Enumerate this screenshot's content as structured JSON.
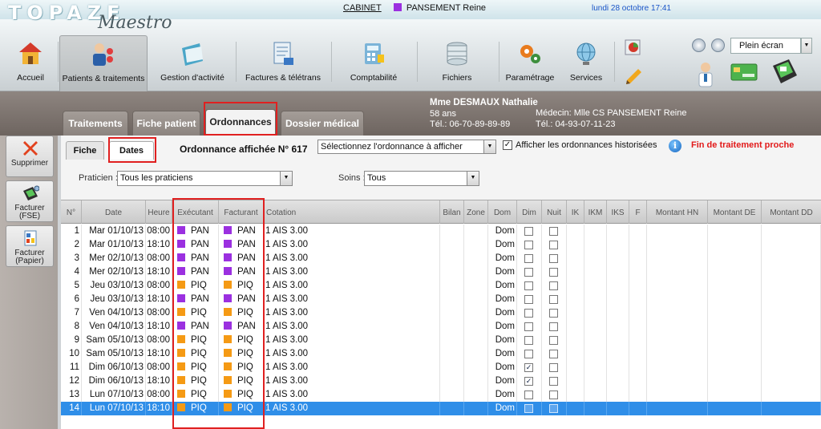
{
  "app": {
    "logo_main": "TOPAZE",
    "logo_sub": "Maestro"
  },
  "topbar": {
    "cabinet_label": "CABINET",
    "cabinet_user": "PANSEMENT Reine",
    "cabinet_color": "#9b30e0",
    "datetime": "lundi 28 octobre 17:41"
  },
  "toolbar": {
    "items": [
      {
        "label": "Accueil",
        "icon": "house-icon"
      },
      {
        "label": "Patients & traitements",
        "icon": "patients-icon"
      },
      {
        "label": "Gestion d'activité",
        "icon": "folder-icon"
      },
      {
        "label": "Factures & télétrans",
        "icon": "invoice-icon"
      },
      {
        "label": "Comptabilité",
        "icon": "calculator-icon"
      },
      {
        "label": "Fichiers",
        "icon": "database-icon"
      },
      {
        "label": "Paramétrage",
        "icon": "gears-icon"
      },
      {
        "label": "Services",
        "icon": "globe-icon"
      }
    ],
    "fullscreen_label": "Plein écran"
  },
  "patient": {
    "tabs": [
      "Traitements",
      "Fiche patient",
      "Ordonnances",
      "Dossier médical"
    ],
    "name": "Mme DESMAUX Nathalie",
    "age": "58 ans",
    "phone": "Tél.: 06-70-89-89-89",
    "doctor": "Médecin: Mlle CS PANSEMENT Reine",
    "doctor_phone": "Tél.: 04-93-07-11-23"
  },
  "sidebar": {
    "buttons": [
      {
        "label_1": "Supprimer",
        "label_2": ""
      },
      {
        "label_1": "Facturer",
        "label_2": "(FSE)"
      },
      {
        "label_1": "Facturer",
        "label_2": "(Papier)"
      }
    ]
  },
  "ordonnance": {
    "subtabs": [
      "Fiche",
      "Dates"
    ],
    "displayed_label": "Ordonnance affichée N° 617",
    "select_placeholder": "Sélectionnez l'ordonnance à afficher",
    "history_label": "Afficher les ordonnances historisées",
    "history_checked": "✓",
    "info_icon": "i",
    "end_warning": "Fin de traitement proche"
  },
  "filters": {
    "praticien_label": "Praticien :",
    "praticien_value": "Tous les praticiens",
    "soins_label": "Soins :",
    "soins_value": "Tous"
  },
  "colors": {
    "PAN": "#9b30e0",
    "PIQ": "#f59a14",
    "selection": "#2f8ee8",
    "alert": "#e21a1a"
  },
  "table": {
    "columns": [
      "N°",
      "Date",
      "Heure",
      "Exécutant",
      "Facturant",
      "Cotation",
      "Bilan",
      "Zone",
      "Dom",
      "Dim",
      "Nuit",
      "IK",
      "IKM",
      "IKS",
      "F",
      "Montant HN",
      "Montant DE",
      "Montant DD"
    ],
    "rows": [
      {
        "n": "1",
        "date": "Mar 01/10/13",
        "heure": "08:00",
        "exec": "PAN",
        "fact": "PAN",
        "cotation": "1 AIS 3.00",
        "dom": "Dom",
        "dim": "",
        "nuit": ""
      },
      {
        "n": "2",
        "date": "Mar 01/10/13",
        "heure": "18:10",
        "exec": "PAN",
        "fact": "PAN",
        "cotation": "1 AIS 3.00",
        "dom": "Dom",
        "dim": "",
        "nuit": ""
      },
      {
        "n": "3",
        "date": "Mer 02/10/13",
        "heure": "08:00",
        "exec": "PAN",
        "fact": "PAN",
        "cotation": "1 AIS 3.00",
        "dom": "Dom",
        "dim": "",
        "nuit": ""
      },
      {
        "n": "4",
        "date": "Mer 02/10/13",
        "heure": "18:10",
        "exec": "PAN",
        "fact": "PAN",
        "cotation": "1 AIS 3.00",
        "dom": "Dom",
        "dim": "",
        "nuit": ""
      },
      {
        "n": "5",
        "date": "Jeu 03/10/13",
        "heure": "08:00",
        "exec": "PIQ",
        "fact": "PIQ",
        "cotation": "1 AIS 3.00",
        "dom": "Dom",
        "dim": "",
        "nuit": ""
      },
      {
        "n": "6",
        "date": "Jeu 03/10/13",
        "heure": "18:10",
        "exec": "PAN",
        "fact": "PAN",
        "cotation": "1 AIS 3.00",
        "dom": "Dom",
        "dim": "",
        "nuit": ""
      },
      {
        "n": "7",
        "date": "Ven 04/10/13",
        "heure": "08:00",
        "exec": "PIQ",
        "fact": "PIQ",
        "cotation": "1 AIS 3.00",
        "dom": "Dom",
        "dim": "",
        "nuit": ""
      },
      {
        "n": "8",
        "date": "Ven 04/10/13",
        "heure": "18:10",
        "exec": "PAN",
        "fact": "PAN",
        "cotation": "1 AIS 3.00",
        "dom": "Dom",
        "dim": "",
        "nuit": ""
      },
      {
        "n": "9",
        "date": "Sam 05/10/13",
        "heure": "08:00",
        "exec": "PIQ",
        "fact": "PIQ",
        "cotation": "1 AIS 3.00",
        "dom": "Dom",
        "dim": "",
        "nuit": ""
      },
      {
        "n": "10",
        "date": "Sam 05/10/13",
        "heure": "18:10",
        "exec": "PIQ",
        "fact": "PIQ",
        "cotation": "1 AIS 3.00",
        "dom": "Dom",
        "dim": "",
        "nuit": ""
      },
      {
        "n": "11",
        "date": "Dim 06/10/13",
        "heure": "08:00",
        "exec": "PIQ",
        "fact": "PIQ",
        "cotation": "1 AIS 3.00",
        "dom": "Dom",
        "dim": "✓",
        "nuit": ""
      },
      {
        "n": "12",
        "date": "Dim 06/10/13",
        "heure": "18:10",
        "exec": "PIQ",
        "fact": "PIQ",
        "cotation": "1 AIS 3.00",
        "dom": "Dom",
        "dim": "✓",
        "nuit": ""
      },
      {
        "n": "13",
        "date": "Lun 07/10/13",
        "heure": "08:00",
        "exec": "PIQ",
        "fact": "PIQ",
        "cotation": "1 AIS 3.00",
        "dom": "Dom",
        "dim": "",
        "nuit": ""
      },
      {
        "n": "14",
        "date": "Lun 07/10/13",
        "heure": "18:10",
        "exec": "PIQ",
        "fact": "PIQ",
        "cotation": "1 AIS 3.00",
        "dom": "Dom",
        "dim": "",
        "nuit": "",
        "selected": true
      }
    ]
  }
}
